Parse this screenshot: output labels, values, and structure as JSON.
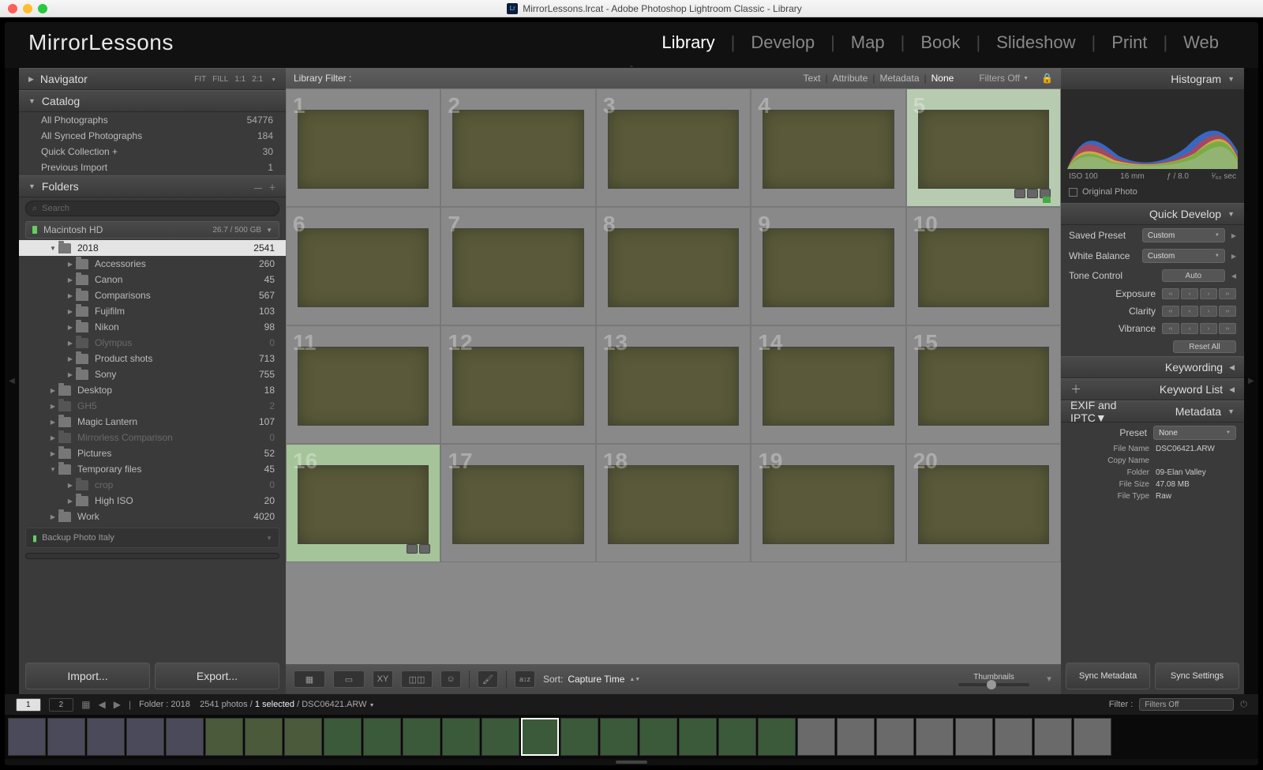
{
  "window_title": "MirrorLessons.lrcat - Adobe Photoshop Lightroom Classic - Library",
  "brand": "MirrorLessons",
  "modules": [
    "Library",
    "Develop",
    "Map",
    "Book",
    "Slideshow",
    "Print",
    "Web"
  ],
  "active_module": "Library",
  "navigator": {
    "title": "Navigator",
    "opts": [
      "FIT",
      "FILL",
      "1:1",
      "2:1"
    ]
  },
  "catalog": {
    "title": "Catalog",
    "items": [
      {
        "label": "All Photographs",
        "count": "54776"
      },
      {
        "label": "All Synced Photographs",
        "count": "184"
      },
      {
        "label": "Quick Collection  +",
        "count": "30"
      },
      {
        "label": "Previous Import",
        "count": "1"
      }
    ]
  },
  "folders": {
    "title": "Folders",
    "search_placeholder": "Search",
    "volume": {
      "name": "Macintosh HD",
      "cap": "26.7 / 500 GB"
    },
    "tree": [
      {
        "d": 1,
        "n": "2018",
        "c": "2541",
        "sel": true,
        "a": "▼"
      },
      {
        "d": 2,
        "n": "Accessories",
        "c": "260",
        "a": "▶"
      },
      {
        "d": 2,
        "n": "Canon",
        "c": "45",
        "a": "▶"
      },
      {
        "d": 2,
        "n": "Comparisons",
        "c": "567",
        "a": "▶"
      },
      {
        "d": 2,
        "n": "Fujifilm",
        "c": "103",
        "a": "▶"
      },
      {
        "d": 2,
        "n": "Nikon",
        "c": "98",
        "a": "▶"
      },
      {
        "d": 2,
        "n": "Olympus",
        "c": "0",
        "a": "▶",
        "dim": true
      },
      {
        "d": 2,
        "n": "Product shots",
        "c": "713",
        "a": "▶"
      },
      {
        "d": 2,
        "n": "Sony",
        "c": "755",
        "a": "▶"
      },
      {
        "d": 1,
        "n": "Desktop",
        "c": "18",
        "a": "▶"
      },
      {
        "d": 1,
        "n": "GH5",
        "c": "2",
        "a": "▶",
        "dim": true
      },
      {
        "d": 1,
        "n": "Magic Lantern",
        "c": "107",
        "a": "▶"
      },
      {
        "d": 1,
        "n": "Mirrorless Comparison",
        "c": "0",
        "a": "▶",
        "dim": true
      },
      {
        "d": 1,
        "n": "Pictures",
        "c": "52",
        "a": "▶"
      },
      {
        "d": 1,
        "n": "Temporary files",
        "c": "45",
        "a": "▼"
      },
      {
        "d": 2,
        "n": "crop",
        "c": "0",
        "a": "▶",
        "dim": true
      },
      {
        "d": 2,
        "n": "High ISO",
        "c": "20",
        "a": "▶"
      },
      {
        "d": 1,
        "n": "Work",
        "c": "4020",
        "a": "▶"
      }
    ],
    "backup_panel": "Backup Photo Italy"
  },
  "import_btn": "Import...",
  "export_btn": "Export...",
  "filterbar": {
    "title": "Library Filter :",
    "items": [
      "Text",
      "Attribute",
      "Metadata",
      "None"
    ],
    "active": "None",
    "filters_off": "Filters Off"
  },
  "grid_cells": [
    1,
    2,
    3,
    4,
    5,
    6,
    7,
    8,
    9,
    10,
    11,
    12,
    13,
    14,
    15,
    16,
    17,
    18,
    19,
    20
  ],
  "toolbar": {
    "sort_label": "Sort:",
    "sort_value": "Capture Time",
    "thumb_label": "Thumbnails"
  },
  "statusbar": {
    "window_tabs": [
      "1",
      "2"
    ],
    "crumb_folder": "Folder : 2018",
    "crumb_count": "2541 photos /",
    "crumb_sel": "1 selected",
    "crumb_file": "/ DSC06421.ARW",
    "filter_label": "Filter :",
    "filter_value": "Filters Off"
  },
  "histogram_title": "Histogram",
  "hist_info": {
    "iso": "ISO 100",
    "fl": "16 mm",
    "ap": "ƒ / 8.0",
    "ss": "¹⁄₆₀ sec"
  },
  "hist_chk": "Original Photo",
  "quick_dev": {
    "title": "Quick Develop",
    "preset_label": "Saved Preset",
    "preset_value": "Custom",
    "wb_label": "White Balance",
    "wb_value": "Custom",
    "tone_label": "Tone Control",
    "tone_btn": "Auto",
    "exposure": "Exposure",
    "clarity": "Clarity",
    "vibrance": "Vibrance",
    "reset": "Reset All"
  },
  "keywording": "Keywording",
  "keyword_list": "Keyword List",
  "metadata": {
    "title": "Metadata",
    "mode": "EXIF and IPTC",
    "preset_label": "Preset",
    "preset_value": "None",
    "rows": [
      {
        "k": "File Name",
        "v": "DSC06421.ARW"
      },
      {
        "k": "Copy Name",
        "v": ""
      },
      {
        "k": "Folder",
        "v": "09-Elan Valley"
      },
      {
        "k": "File Size",
        "v": "47.08 MB"
      },
      {
        "k": "File Type",
        "v": "Raw"
      }
    ]
  },
  "sync_meta": "Sync Metadata",
  "sync_settings": "Sync Settings"
}
